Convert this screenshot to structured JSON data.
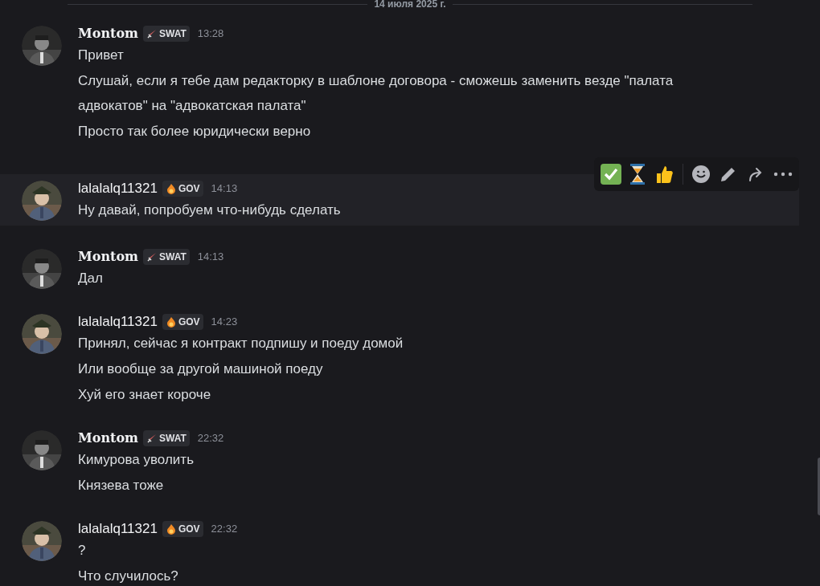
{
  "date_divider": "14 июля 2025 г.",
  "messages": [
    {
      "author": "Montom",
      "kind": "fancy",
      "tag": {
        "kind": "sword",
        "label": "SWAT"
      },
      "time": "13:28",
      "hovered": false,
      "lines": [
        "Привет",
        "Слушай, если я тебе дам редакторку в шаблоне договора - сможешь заменить везде \"палата адвокатов\" на \"адвокатская палата\"",
        "Просто так более юридически верно"
      ]
    },
    {
      "author": "lalalalq11321",
      "kind": "plain",
      "tag": {
        "kind": "flame",
        "label": "GOV"
      },
      "time": "14:13",
      "hovered": true,
      "lines": [
        "Ну давай, попробуем что-нибудь сделать"
      ]
    },
    {
      "author": "Montom",
      "kind": "fancy",
      "tag": {
        "kind": "sword",
        "label": "SWAT"
      },
      "time": "14:13",
      "hovered": false,
      "lines": [
        "Дал"
      ]
    },
    {
      "author": "lalalalq11321",
      "kind": "plain",
      "tag": {
        "kind": "flame",
        "label": "GOV"
      },
      "time": "14:23",
      "hovered": false,
      "lines": [
        "Принял, сейчас я контракт подпишу и поеду домой",
        "Или вообще за другой машиной поеду",
        "Хуй его знает короче"
      ]
    },
    {
      "author": "Montom",
      "kind": "fancy",
      "tag": {
        "kind": "sword",
        "label": "SWAT"
      },
      "time": "22:32",
      "hovered": false,
      "lines": [
        "Кимурова уволить",
        "Князева тоже"
      ]
    },
    {
      "author": "lalalalq11321",
      "kind": "plain",
      "tag": {
        "kind": "flame",
        "label": "GOV"
      },
      "time": "22:32",
      "hovered": false,
      "lines": [
        "?",
        "Что случилось?"
      ]
    }
  ],
  "hover_toolbar": [
    {
      "kind": "check"
    },
    {
      "kind": "hourglass"
    },
    {
      "kind": "thumb"
    },
    {
      "kind": "divider"
    },
    {
      "kind": "smile"
    },
    {
      "kind": "pencil"
    },
    {
      "kind": "reply"
    },
    {
      "kind": "more"
    }
  ]
}
